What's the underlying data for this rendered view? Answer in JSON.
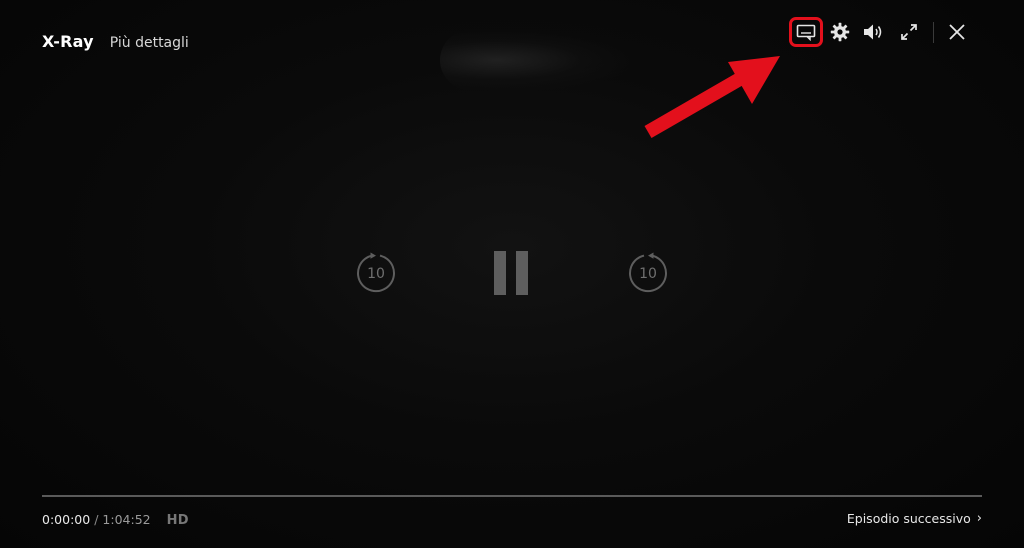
{
  "header": {
    "xray_label": "X-Ray",
    "details_label": "Più dettagli"
  },
  "controls": {
    "subtitles_icon": "subtitles-icon",
    "settings_icon": "gear-icon",
    "volume_icon": "volume-icon",
    "fullscreen_icon": "fullscreen-icon",
    "close_icon": "close-icon",
    "rewind_seconds": "10",
    "forward_seconds": "10",
    "playback_state": "playing"
  },
  "progress": {
    "current_time": "0:00:00",
    "separator": "/",
    "total_time": "1:04:52",
    "fraction": 0.0,
    "quality_badge": "HD"
  },
  "footer": {
    "next_episode_label": "Episodio successivo",
    "next_chevron": "›"
  },
  "colors": {
    "annotation": "#e3101c",
    "icon": "#e6e6e6",
    "center_icon": "#5e5e5e"
  }
}
